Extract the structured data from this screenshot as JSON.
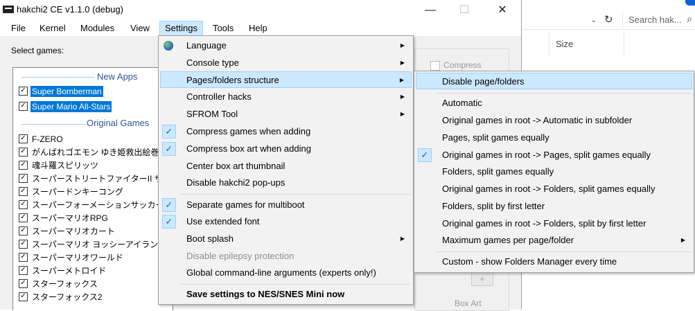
{
  "window": {
    "title": "hakchi2 CE v1.1.0 (debug)",
    "minimize_symbol": "—",
    "maximize_symbol": "☐",
    "close_symbol": "✕"
  },
  "menubar": [
    "File",
    "Kernel",
    "Modules",
    "View",
    "Settings",
    "Tools",
    "Help"
  ],
  "select_games_label": "Select games:",
  "games_list": {
    "new_apps_header": "New Apps",
    "original_games_header": "Original Games",
    "new_apps": [
      "Super Bomberman",
      "Super Mario All-Stars"
    ],
    "original_games": [
      "F-ZERO",
      "がんばれゴエモン ゆき姫救出絵巻",
      "魂斗羅スピリッツ",
      "スーパーストリートファイターII ザ ニュ",
      "スーパードンキーコング",
      "スーパーフォーメーションサッカー",
      "スーパーマリオRPG",
      "スーパーマリオカート",
      "スーパーマリオ ヨッシーアイランド",
      "スーパーマリオワールド",
      "スーパーメトロイド",
      "スターフォックス",
      "スターフォックス2"
    ],
    "check_mark": "✓"
  },
  "settings_menu": {
    "items": [
      {
        "label": "Language",
        "submenu": true,
        "icon": "globe-icon"
      },
      {
        "label": "Console type",
        "submenu": true
      },
      {
        "label": "Pages/folders structure",
        "submenu": true,
        "highlighted": true
      },
      {
        "label": "Controller hacks",
        "submenu": true
      },
      {
        "label": "SFROM Tool",
        "submenu": true
      },
      {
        "label": "Compress games when adding",
        "checked": true
      },
      {
        "label": "Compress box art when adding",
        "checked": true
      },
      {
        "label": "Center box art thumbnail"
      },
      {
        "label": "Disable hakchi2 pop-ups"
      },
      {
        "label": "Separate games for multiboot",
        "checked": true
      },
      {
        "label": "Use extended font",
        "checked": true
      },
      {
        "label": "Boot splash",
        "submenu": true
      },
      {
        "label": "Disable epilepsy protection",
        "disabled": true
      },
      {
        "label": "Global command-line arguments (experts only!)"
      },
      {
        "label": "Save settings to NES/SNES Mini now",
        "bold": true
      }
    ],
    "arrow": "▶",
    "check": "✓"
  },
  "pages_submenu": {
    "items": [
      {
        "label": "Disable page/folders",
        "highlighted": true
      },
      {
        "label": "Automatic"
      },
      {
        "label": "Original games in root -> Automatic in subfolder"
      },
      {
        "label": "Pages, split games equally"
      },
      {
        "label": "Original games in root -> Pages, split games equally",
        "checked": true
      },
      {
        "label": "Folders, split games equally"
      },
      {
        "label": "Original games in root -> Folders, split games equally"
      },
      {
        "label": "Folders, split by first letter"
      },
      {
        "label": "Original games in root -> Folders, split by first letter"
      },
      {
        "label": "Maximum games per page/folder",
        "submenu": true
      },
      {
        "label": "Custom - show Folders Manager every time"
      }
    ]
  },
  "right_panel": {
    "compress_label": "Compress",
    "plus_label": "+",
    "box_art_label": "Box Art"
  },
  "explorer": {
    "dropdown_symbol": "⌄",
    "refresh_symbol": "↻",
    "search_placeholder": "Search hak...",
    "search_icon_glyph": "⌕",
    "size_header": "Size"
  },
  "colors": {
    "selection": "#0078d7",
    "menu_highlight": "#cce8ff",
    "group_header": "#2f5597"
  }
}
